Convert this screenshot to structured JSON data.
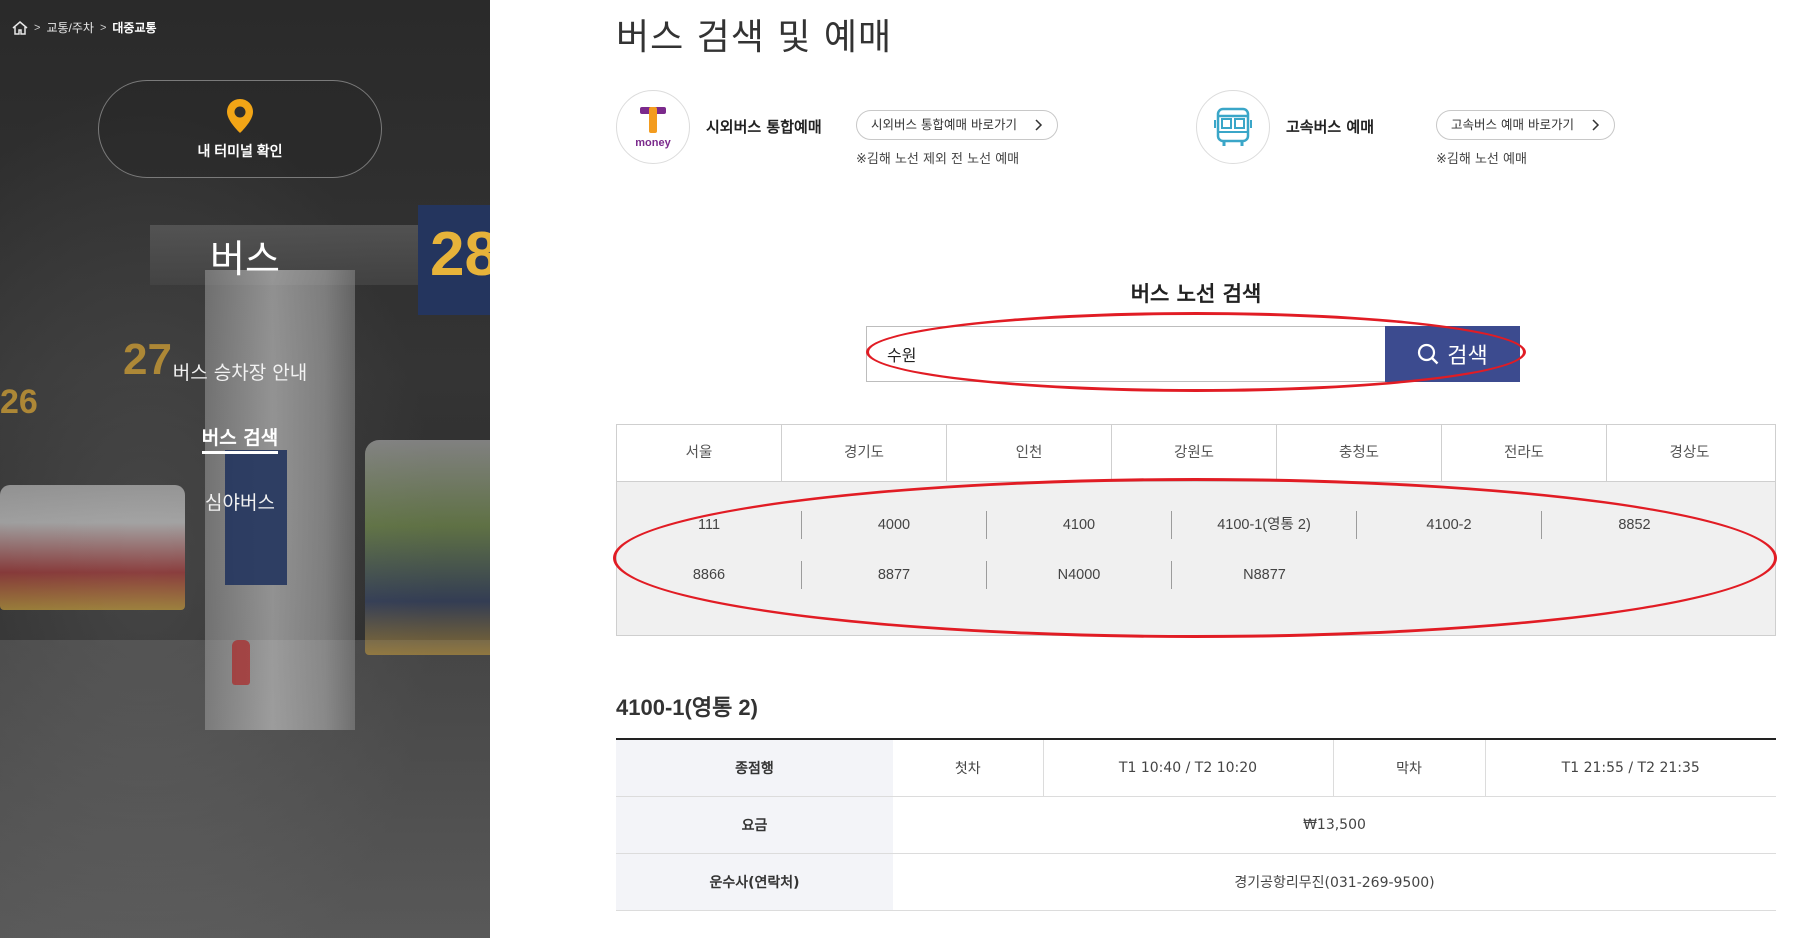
{
  "breadcrumb": {
    "items": [
      "교통/주차",
      "대중교통"
    ]
  },
  "sidebar": {
    "terminal_button": "내 터미널 확인",
    "title": "버스",
    "menu": [
      {
        "label": "버스 승차장 안내",
        "active": false
      },
      {
        "label": "버스 검색",
        "active": true
      },
      {
        "label": "심야버스",
        "active": false
      }
    ],
    "photo_signs": [
      "28",
      "27",
      "26"
    ]
  },
  "page_title": "버스 검색 및 예매",
  "reservations": [
    {
      "name": "시외버스 통합예매",
      "link_label": "시외버스 통합예매 바로가기",
      "note": "※김해 노선 제외 전 노선 예매",
      "logo": "tmoney-logo",
      "logo_text": "money"
    },
    {
      "name": "고속버스 예매",
      "link_label": "고속버스 예매 바로가기",
      "note": "※김해 노선 예매",
      "logo": "bus-icon"
    }
  ],
  "search": {
    "title": "버스 노선 검색",
    "value": "수원",
    "button_label": "검색"
  },
  "regions": [
    "서울",
    "경기도",
    "인천",
    "강원도",
    "충청도",
    "전라도",
    "경상도"
  ],
  "routes": [
    [
      "111",
      "4000",
      "4100",
      "4100-1(영통 2)",
      "4100-2",
      "8852"
    ],
    [
      "8866",
      "8877",
      "N4000",
      "N8877"
    ]
  ],
  "detail": {
    "title": "4100-1(영통 2)",
    "rows": {
      "terminus_label": "종점행",
      "first_label": "첫차",
      "first_value": "T1 10:40 / T2 10:20",
      "last_label": "막차",
      "last_value": "T1 21:55 / T2 21:35",
      "fare_label": "요금",
      "fare_value": "₩13,500",
      "operator_label": "운수사(연락처)",
      "operator_value": "경기공항리무진(031-269-9500)"
    }
  },
  "colors": {
    "accent_navy": "#3c4b8f",
    "highlight_red": "#e11c24",
    "pin_orange": "#f2a516",
    "tmoney_purple": "#7b2a8c",
    "tmoney_orange": "#f39c1f",
    "bus_teal": "#3aa6c8"
  }
}
